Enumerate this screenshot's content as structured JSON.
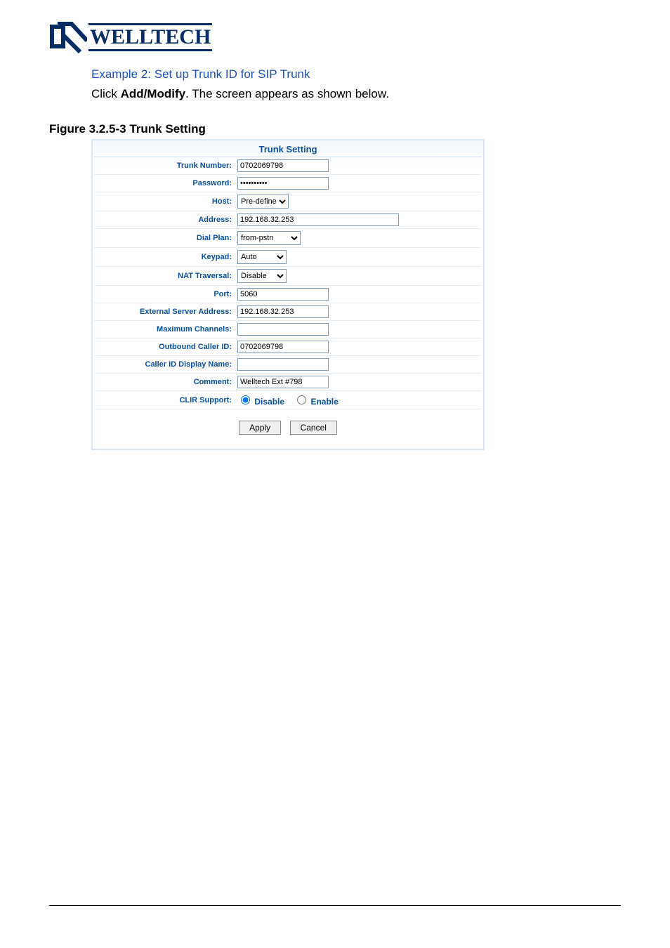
{
  "logo": {
    "brand": "WELLTECH"
  },
  "example_title": "Example 2: Set up Trunk ID for SIP Trunk",
  "desc_prefix": "Click ",
  "desc_bold": "Add/Modify",
  "desc_suffix": ". The screen appears as shown below.",
  "figure_caption": "Figure   3.2.5-3 Trunk Setting",
  "form": {
    "header": "Trunk Setting",
    "labels": {
      "trunk_number": "Trunk Number:",
      "password": "Password:",
      "host": "Host:",
      "address": "Address:",
      "dial_plan": "Dial Plan:",
      "keypad": "Keypad:",
      "nat_traversal": "NAT Traversal:",
      "port": "Port:",
      "ext_server": "External Server Address:",
      "max_channels": "Maximum Channels:",
      "outbound_caller": "Outbound Caller ID:",
      "caller_display": "Caller ID Display Name:",
      "comment": "Comment:",
      "clir": "CLIR Support:"
    },
    "values": {
      "trunk_number": "0702069798",
      "password": "••••••••••",
      "host": "Pre-define",
      "address": "192.168.32.253",
      "dial_plan": "from-pstn",
      "keypad": "Auto",
      "nat_traversal": "Disable",
      "port": "5060",
      "ext_server": "192.168.32.253",
      "max_channels": "",
      "outbound_caller": "0702069798",
      "caller_display": "",
      "comment": "Welltech Ext #798"
    },
    "clir_options": {
      "disable": "Disable",
      "enable": "Enable"
    },
    "buttons": {
      "apply": "Apply",
      "cancel": "Cancel"
    }
  }
}
